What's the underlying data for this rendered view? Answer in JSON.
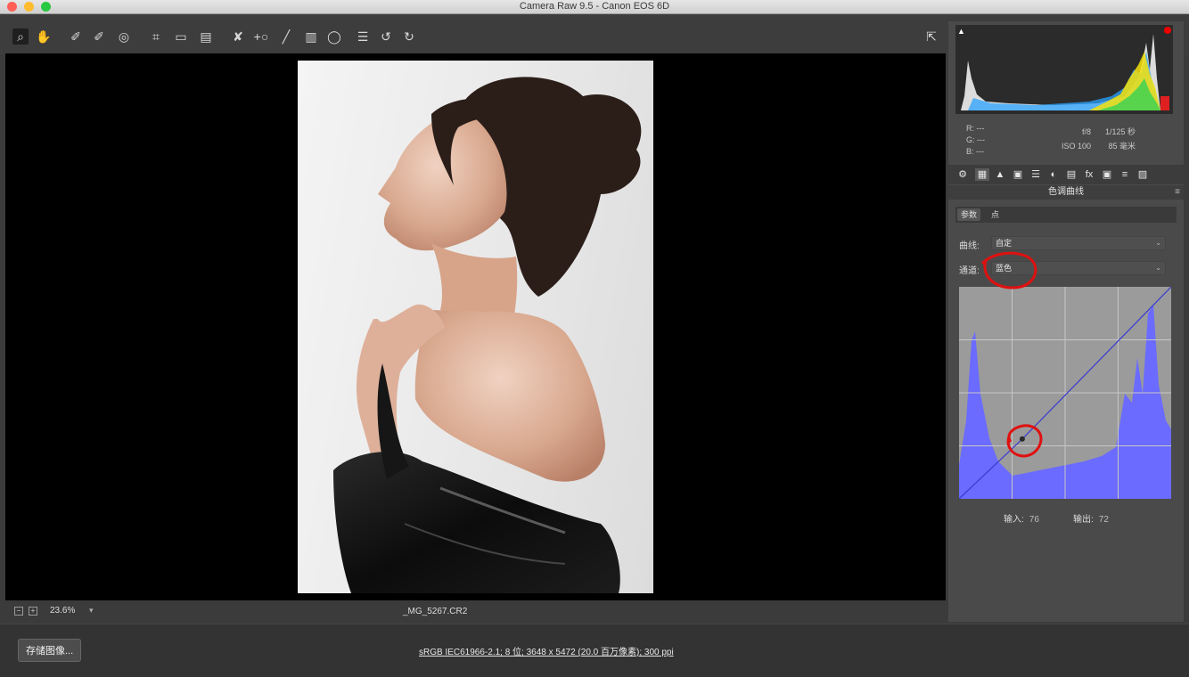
{
  "window": {
    "title": "Camera Raw 9.5 -  Canon EOS 6D",
    "lights": [
      "#ff5f57",
      "#febc2e",
      "#28c840"
    ]
  },
  "toolbar": {
    "tools": [
      {
        "name": "zoom-tool-icon",
        "glyph": "⌕"
      },
      {
        "name": "hand-tool-icon",
        "glyph": "✋"
      },
      {
        "name": "white-balance-tool-icon",
        "glyph": "✐"
      },
      {
        "name": "color-sampler-tool-icon",
        "glyph": "✐"
      },
      {
        "name": "targeted-adjustment-tool-icon",
        "glyph": "◎"
      },
      {
        "name": "crop-tool-icon",
        "glyph": "⌗"
      },
      {
        "name": "straighten-tool-icon",
        "glyph": "▭"
      },
      {
        "name": "transform-tool-icon",
        "glyph": "▤"
      },
      {
        "name": "spot-removal-tool-icon",
        "glyph": "✘"
      },
      {
        "name": "red-eye-removal-icon",
        "glyph": "+○"
      },
      {
        "name": "adjustment-brush-icon",
        "glyph": "╱"
      },
      {
        "name": "graduated-filter-icon",
        "glyph": "▥"
      },
      {
        "name": "radial-filter-icon",
        "glyph": "◯"
      },
      {
        "name": "preferences-icon",
        "glyph": "☰"
      },
      {
        "name": "rotate-ccw-icon",
        "glyph": "↺"
      },
      {
        "name": "rotate-cw-icon",
        "glyph": "↻"
      }
    ],
    "fullscreen_icon": "⇱"
  },
  "canvas": {
    "zoom": "23.6%",
    "zoom_dropdown": "▾",
    "filename": "_MG_5267.CR2"
  },
  "bottom": {
    "save_label": "存储图像...",
    "workflow": "sRGB IEC61966-2.1;  8 位;  3648 x 5472 (20.0 百万像素);  300 ppi"
  },
  "histogram": {
    "shadow_clip": "▲"
  },
  "info": {
    "rgb": [
      "R:  ---",
      "G:  ---",
      "B:  ---"
    ],
    "camera": [
      [
        "f/8",
        "1/125 秒"
      ],
      [
        "ISO 100",
        "85 毫米"
      ]
    ]
  },
  "panel_tabs": [
    "⚙",
    "▦",
    "▲",
    "▣",
    "☰",
    "◐",
    "▤",
    "fx",
    "▣",
    "≡",
    "▨"
  ],
  "panel": {
    "title": "色调曲线",
    "menu_icon": "≡",
    "subtabs": [
      "参数",
      "点"
    ],
    "curve_label": "曲线:",
    "curve_value": "自定",
    "channel_label": "通道:",
    "channel_value": "蓝色",
    "caret": "⌄",
    "input_label": "输入:",
    "input_value": "76",
    "output_label": "输出:",
    "output_value": "72"
  },
  "curve": {
    "channel_color": "#6b6bff",
    "point": {
      "input": 76,
      "output": 72
    },
    "annotation_color": "#e01010"
  }
}
